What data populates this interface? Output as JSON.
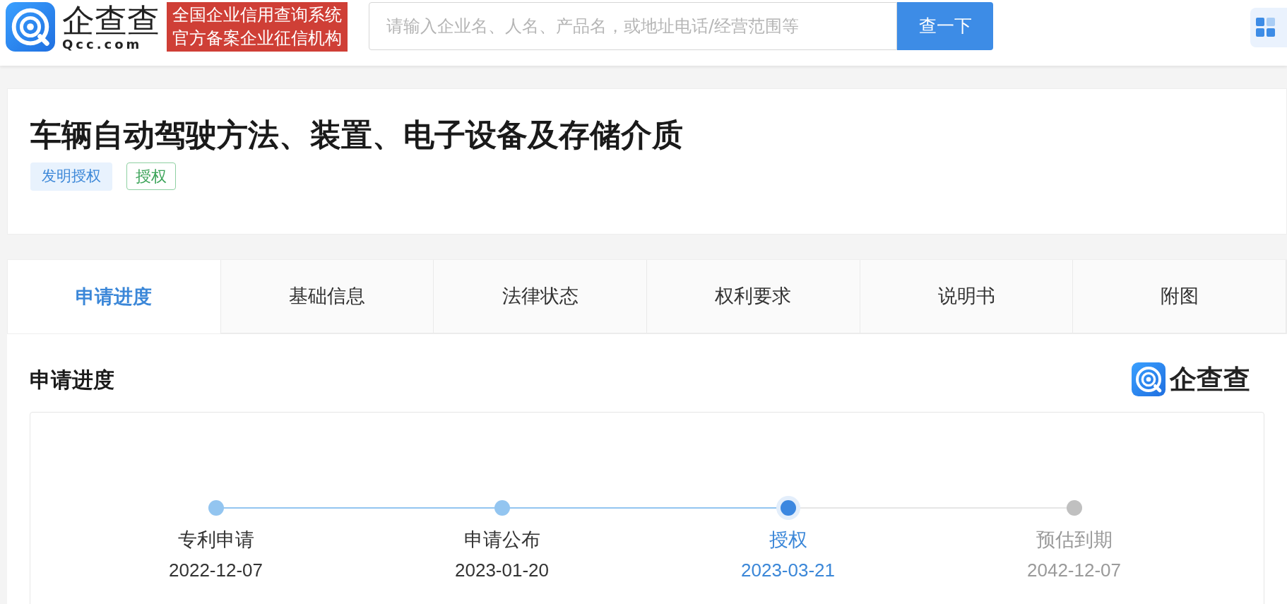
{
  "header": {
    "logo": {
      "name": "企查查",
      "domain": "Qcc.com"
    },
    "badge_lines": [
      "全国企业信用查询系统",
      "官方备案企业征信机构"
    ],
    "search": {
      "placeholder": "请输入企业名、人名、产品名，或地址电话/经营范围等"
    },
    "search_button": "查一下"
  },
  "patent": {
    "title": "车辆自动驾驶方法、装置、电子设备及存储介质",
    "tags": [
      {
        "label": "发明授权",
        "kind": "filled"
      },
      {
        "label": "授权",
        "kind": "outline"
      }
    ]
  },
  "tabs": [
    {
      "label": "申请进度",
      "selected": true
    },
    {
      "label": "基础信息",
      "selected": false
    },
    {
      "label": "法律状态",
      "selected": false
    },
    {
      "label": "权利要求",
      "selected": false
    },
    {
      "label": "说明书",
      "selected": false
    },
    {
      "label": "附图",
      "selected": false
    }
  ],
  "section": {
    "title": "申请进度",
    "logo_name": "企查查"
  },
  "timeline": [
    {
      "label": "专利申请",
      "date": "2022-12-07",
      "kind": "done"
    },
    {
      "label": "申请公布",
      "date": "2023-01-20",
      "kind": "done"
    },
    {
      "label": "授权",
      "date": "2023-03-21",
      "kind": "current"
    },
    {
      "label": "预估到期",
      "date": "2042-12-07",
      "kind": "future"
    }
  ]
}
